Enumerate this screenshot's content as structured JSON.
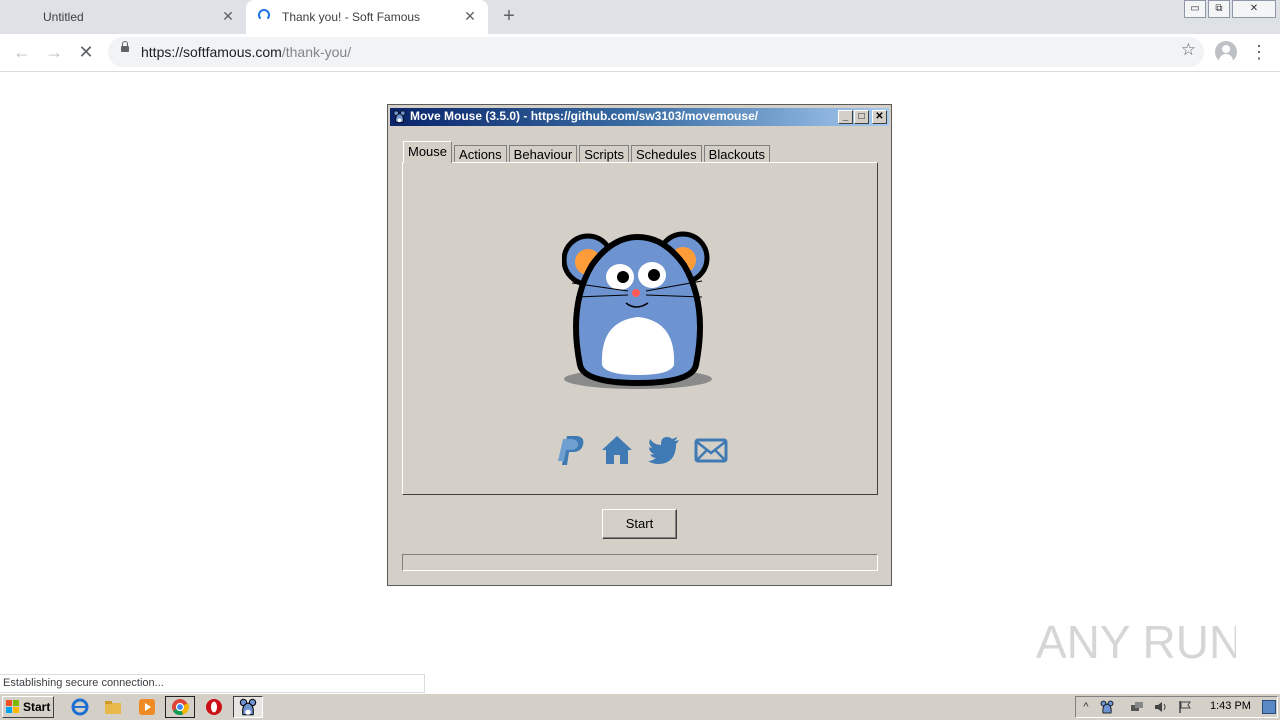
{
  "browser": {
    "tabs": [
      {
        "title": "Untitled",
        "close": "✕"
      },
      {
        "title": "Thank you! - Soft Famous",
        "close": "✕"
      }
    ],
    "new_tab": "+",
    "window_controls": {
      "minimize": "▭",
      "restore": "⧉",
      "close": "✕"
    },
    "nav": {
      "back": "←",
      "forward": "→",
      "stop": "✕",
      "menu": "⋮",
      "star": "☆"
    },
    "url": {
      "origin": "https://softfamous.com",
      "path": "/thank-you/"
    },
    "status": "Establishing secure connection..."
  },
  "app": {
    "title": "Move Mouse (3.5.0) - https://github.com/sw3103/movemouse/",
    "window_controls": {
      "minimize": "_",
      "maximize": "□",
      "close": "✕"
    },
    "tabs": [
      "Mouse",
      "Actions",
      "Behaviour",
      "Scripts",
      "Schedules",
      "Blackouts"
    ],
    "selected_tab": "Mouse",
    "start_label": "Start",
    "progress": 0,
    "links": [
      "paypal-icon",
      "home-icon",
      "twitter-icon",
      "mail-icon"
    ],
    "accent_color": "#3f7ab5"
  },
  "taskbar": {
    "start_label": "Start",
    "clock": "1:43 PM",
    "apps": [
      "ie-icon",
      "explorer-icon",
      "media-player-icon",
      "chrome-icon",
      "opera-icon",
      "move-mouse-icon"
    ]
  },
  "watermark": {
    "text": "ANY RUN"
  }
}
